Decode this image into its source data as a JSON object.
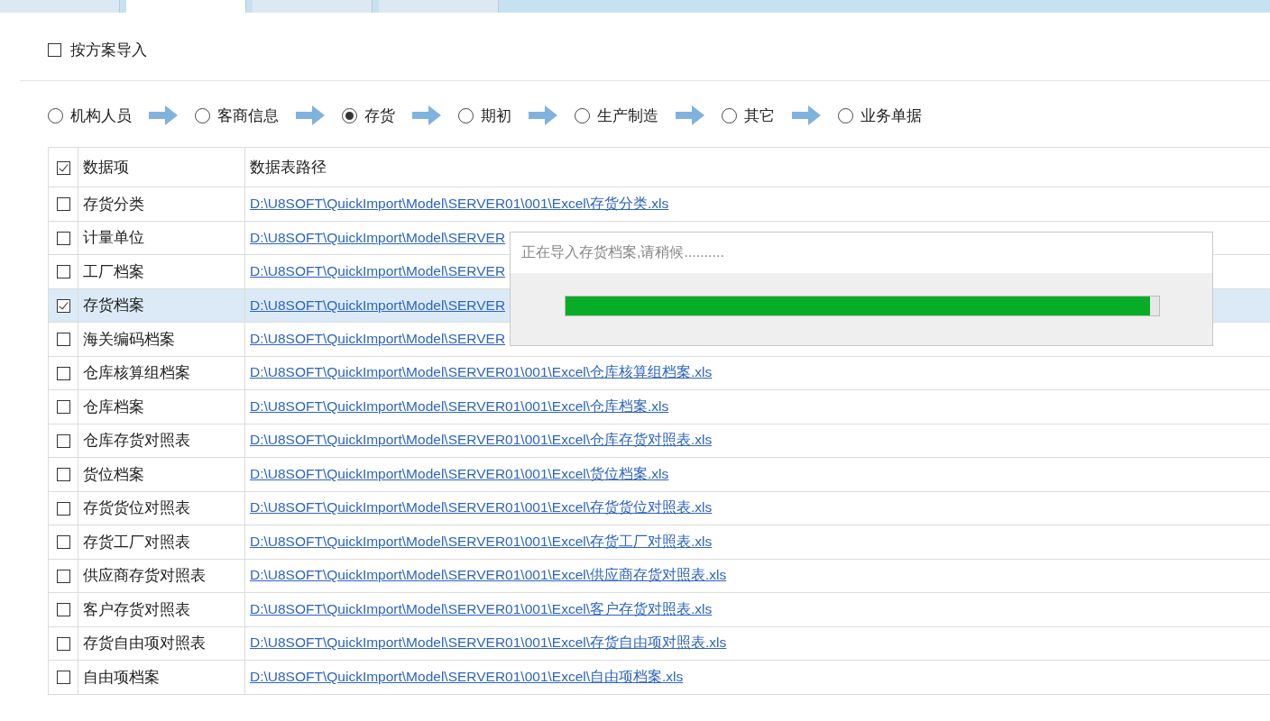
{
  "tabs": [
    {
      "selected": false
    },
    {
      "selected": true
    },
    {
      "selected": false
    },
    {
      "selected": false
    }
  ],
  "import_by_plan": {
    "label": "按方案导入",
    "checked": false
  },
  "steps": [
    {
      "label": "机构人员",
      "selected": false
    },
    {
      "label": "客商信息",
      "selected": false
    },
    {
      "label": "存货",
      "selected": true
    },
    {
      "label": "期初",
      "selected": false
    },
    {
      "label": "生产制造",
      "selected": false
    },
    {
      "label": "其它",
      "selected": false
    },
    {
      "label": "业务单据",
      "selected": false
    }
  ],
  "table": {
    "all_checked": true,
    "columns": [
      "数据项",
      "数据表路径"
    ],
    "rows": [
      {
        "name": "存货分类",
        "path": "D:\\U8SOFT\\QuickImport\\Model\\SERVER01\\001\\Excel\\存货分类.xls",
        "checked": false,
        "selected": false
      },
      {
        "name": "计量单位",
        "path": "D:\\U8SOFT\\QuickImport\\Model\\SERVER",
        "checked": false,
        "selected": false
      },
      {
        "name": "工厂档案",
        "path": "D:\\U8SOFT\\QuickImport\\Model\\SERVER",
        "checked": false,
        "selected": false
      },
      {
        "name": "存货档案",
        "path": "D:\\U8SOFT\\QuickImport\\Model\\SERVER",
        "checked": true,
        "selected": true
      },
      {
        "name": "海关编码档案",
        "path": "D:\\U8SOFT\\QuickImport\\Model\\SERVER",
        "checked": false,
        "selected": false
      },
      {
        "name": "仓库核算组档案",
        "path": "D:\\U8SOFT\\QuickImport\\Model\\SERVER01\\001\\Excel\\仓库核算组档案.xls",
        "checked": false,
        "selected": false
      },
      {
        "name": "仓库档案",
        "path": "D:\\U8SOFT\\QuickImport\\Model\\SERVER01\\001\\Excel\\仓库档案.xls",
        "checked": false,
        "selected": false
      },
      {
        "name": "仓库存货对照表",
        "path": "D:\\U8SOFT\\QuickImport\\Model\\SERVER01\\001\\Excel\\仓库存货对照表.xls",
        "checked": false,
        "selected": false
      },
      {
        "name": "货位档案",
        "path": "D:\\U8SOFT\\QuickImport\\Model\\SERVER01\\001\\Excel\\货位档案.xls",
        "checked": false,
        "selected": false
      },
      {
        "name": "存货货位对照表",
        "path": "D:\\U8SOFT\\QuickImport\\Model\\SERVER01\\001\\Excel\\存货货位对照表.xls",
        "checked": false,
        "selected": false
      },
      {
        "name": "存货工厂对照表",
        "path": "D:\\U8SOFT\\QuickImport\\Model\\SERVER01\\001\\Excel\\存货工厂对照表.xls",
        "checked": false,
        "selected": false
      },
      {
        "name": "供应商存货对照表",
        "path": "D:\\U8SOFT\\QuickImport\\Model\\SERVER01\\001\\Excel\\供应商存货对照表.xls",
        "checked": false,
        "selected": false
      },
      {
        "name": "客户存货对照表",
        "path": "D:\\U8SOFT\\QuickImport\\Model\\SERVER01\\001\\Excel\\客户存货对照表.xls",
        "checked": false,
        "selected": false
      },
      {
        "name": "存货自由项对照表",
        "path": "D:\\U8SOFT\\QuickImport\\Model\\SERVER01\\001\\Excel\\存货自由项对照表.xls",
        "checked": false,
        "selected": false
      },
      {
        "name": "自由项档案",
        "path": "D:\\U8SOFT\\QuickImport\\Model\\SERVER01\\001\\Excel\\自由项档案.xls",
        "checked": false,
        "selected": false
      }
    ]
  },
  "progress_dialog": {
    "message": "正在导入存货档案,请稍候..........",
    "level": 0.985
  }
}
